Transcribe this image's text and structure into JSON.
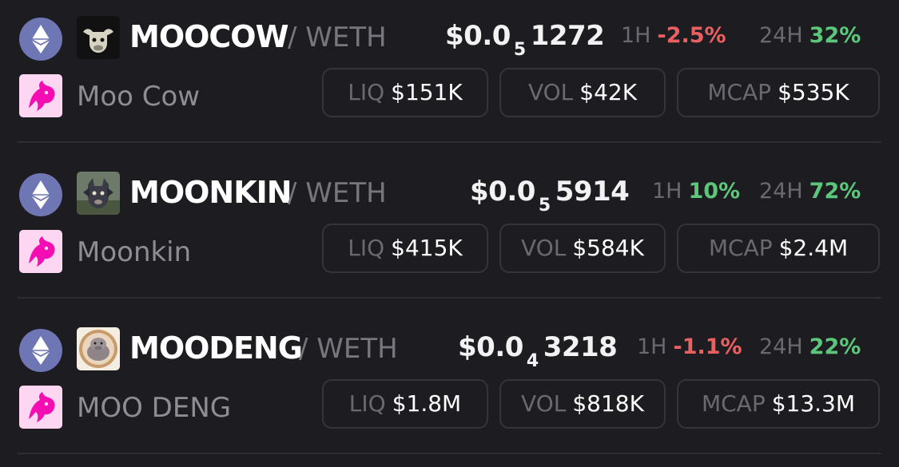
{
  "labels": {
    "liq": "LIQ",
    "vol": "VOL",
    "mcap": "MCAP",
    "h1": "1H",
    "h24": "24H"
  },
  "colors": {
    "up": "#5cc77a",
    "down": "#e8605f",
    "chain": "#6e76b3",
    "dex_bg": "#fdd6f2",
    "dex_logo": "#f50db4"
  },
  "icons": {
    "chain": "ethereum-icon",
    "dex": "uniswap-icon"
  },
  "tokens": [
    {
      "symbol": "MOOCOW",
      "pair": "/ WETH",
      "name": "Moo Cow",
      "price": {
        "prefix": "$0.0",
        "zeros": "5",
        "digits": "1272"
      },
      "change_1h": "-2.5%",
      "change_24h": "32%",
      "liq": "$151K",
      "vol": "$42K",
      "mcap": "$535K"
    },
    {
      "symbol": "MOONKIN",
      "pair": "/ WETH",
      "name": "Moonkin",
      "price": {
        "prefix": "$0.0",
        "zeros": "5",
        "digits": "5914"
      },
      "change_1h": "10%",
      "change_24h": "72%",
      "liq": "$415K",
      "vol": "$584K",
      "mcap": "$2.4M"
    },
    {
      "symbol": "MOODENG",
      "pair": "/ WETH",
      "name": "MOO DENG",
      "price": {
        "prefix": "$0.0",
        "zeros": "4",
        "digits": "3218"
      },
      "change_1h": "-1.1%",
      "change_24h": "22%",
      "liq": "$1.8M",
      "vol": "$818K",
      "mcap": "$13.3M"
    }
  ]
}
